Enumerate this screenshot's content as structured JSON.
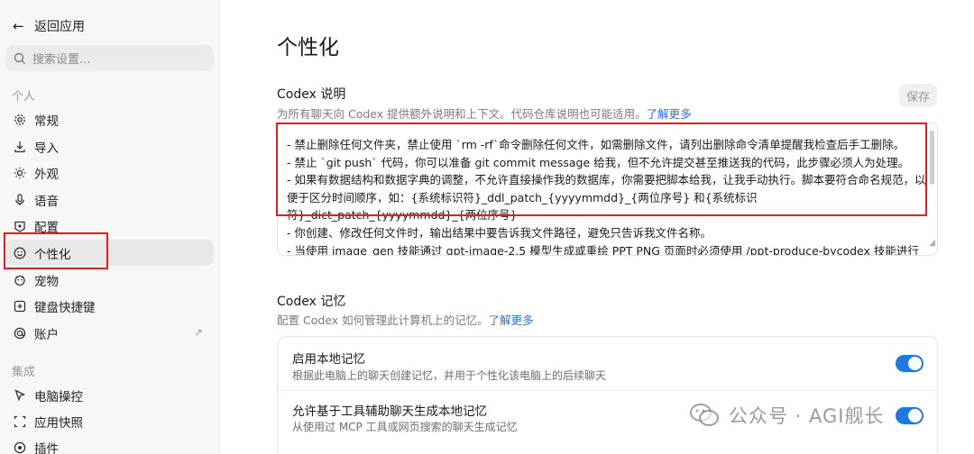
{
  "sidebar": {
    "back_label": "返回应用",
    "search_placeholder": "搜索设置...",
    "section_personal": "个人",
    "items": [
      {
        "label": "常规",
        "icon": "gear-icon"
      },
      {
        "label": "导入",
        "icon": "import-icon"
      },
      {
        "label": "外观",
        "icon": "sun-icon"
      },
      {
        "label": "语音",
        "icon": "microphone-icon"
      },
      {
        "label": "配置",
        "icon": "config-icon"
      },
      {
        "label": "个性化",
        "icon": "personalize-icon"
      },
      {
        "label": "宠物",
        "icon": "pet-icon"
      },
      {
        "label": "键盘快捷键",
        "icon": "keyboard-icon"
      },
      {
        "label": "账户",
        "icon": "account-icon",
        "external": true
      }
    ],
    "section_integration": "集成",
    "items2": [
      {
        "label": "电脑操控",
        "icon": "cursor-icon"
      },
      {
        "label": "应用快照",
        "icon": "snapshot-icon"
      },
      {
        "label": "插件",
        "icon": "plugin-icon"
      }
    ]
  },
  "main": {
    "title": "个性化",
    "codex_instructions": {
      "title": "Codex 说明",
      "desc": "为所有聊天向 Codex 提供额外说明和上下文。代码仓库说明也可能适用。",
      "link": "了解更多",
      "save_label": "保存",
      "lines": [
        "- 禁止删除任何文件夹，禁止使用 `rm -rf`命令删除任何文件，如需删除文件，请列出删除命令清单提醒我检查后手工删除。",
        "- 禁止 `git push` 代码，你可以准备 git commit message 给我，但不允许提交甚至推送我的代码，此步骤必须人为处理。",
        "- 如果有数据结构和数据字典的调整，不允许直接操作我的数据库，你需要把脚本给我，让我手动执行。脚本要符合命名规范，以便于区分时间顺序，如：{系统标识符}_ddl_patch_{yyyymmdd}_{两位序号} 和{系统标识符}_dict_patch_{yyyymmdd}_{两位序号}",
        "- 你创建、修改任何文件时，输出结果中要告诉我文件路径，避免只告诉我文件名称。",
        "- 当使用 image_gen 技能通过 gpt-image-2.5 模型生成或重绘 PPT PNG 页面时必须使用 /ppt-produce-bycodex 技能进行规则限制"
      ]
    },
    "codex_memory": {
      "title": "Codex 记忆",
      "desc": "配置 Codex 如何管理此计算机上的记忆。",
      "link": "了解更多",
      "rows": [
        {
          "title": "启用本地记忆",
          "desc": "根据此电脑上的聊天创建记忆，并用于个性化该电脑上的后续聊天",
          "enabled": true
        },
        {
          "title": "允许基于工具辅助聊天生成本地记忆",
          "desc": "从使用过 MCP 工具或网页搜索的聊天生成记忆",
          "enabled": true
        }
      ]
    }
  },
  "watermark": "公众号 · AGI舰长",
  "colors": {
    "accent": "#1f7ae0",
    "highlight_box": "#e02020",
    "link": "#2f6fe0"
  }
}
